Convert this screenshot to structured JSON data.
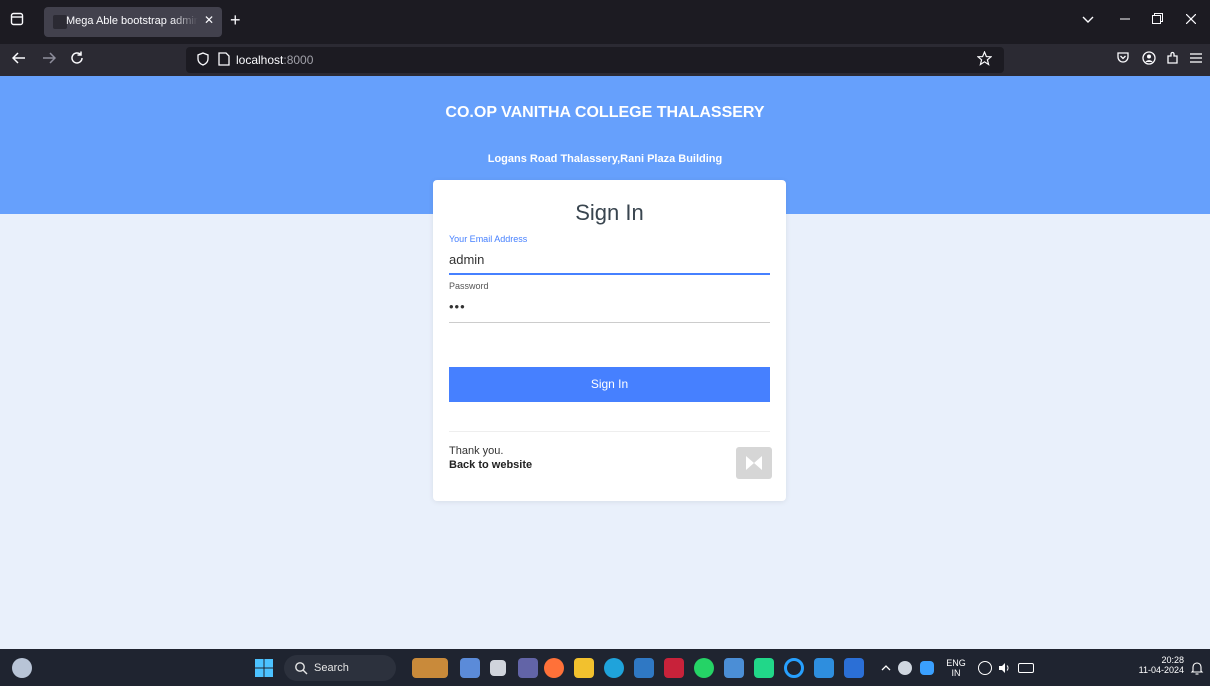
{
  "browser": {
    "tab_title": "Mega Able bootstrap admin template",
    "tab_close": "✕",
    "new_tab": "+",
    "url_host": "localhost",
    "url_port": ":8000"
  },
  "header": {
    "college_name": "CO.OP VANITHA COLLEGE THALASSERY",
    "address": "Logans Road Thalassery,Rani Plaza Building"
  },
  "login": {
    "title": "Sign In",
    "email_label": "Your Email Address",
    "email_value": "admin",
    "password_label": "Password",
    "password_value": "•••",
    "submit_label": "Sign In",
    "thanks_text": "Thank you.",
    "back_link": "Back to website"
  },
  "taskbar": {
    "search_label": "Search",
    "lang_top": "ENG",
    "lang_bottom": "IN",
    "time": "20:28",
    "date": "11-04-2024"
  },
  "colors": {
    "header_band": "#66a0fc",
    "primary": "#4680ff",
    "page_bg": "#e9f0fb"
  }
}
